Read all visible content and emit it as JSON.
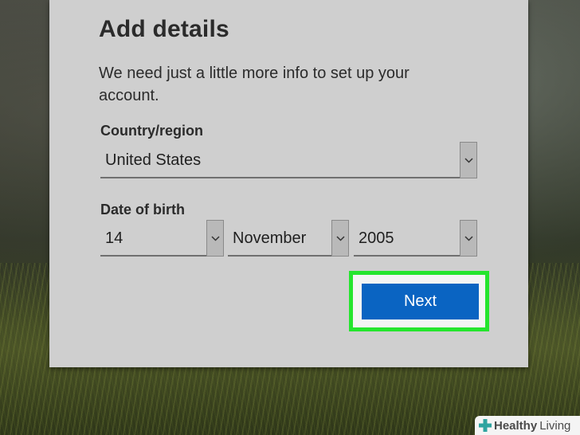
{
  "dialog": {
    "title": "Add details",
    "intro": "We need just a little more info to set up your account.",
    "country": {
      "label": "Country/region",
      "value": "United States"
    },
    "birth": {
      "label": "Date of birth",
      "day": "14",
      "month": "November",
      "year": "2005"
    },
    "next_label": "Next",
    "highlight_color": "#25e52e",
    "button_color": "#0a64c2"
  },
  "watermark": {
    "brand_a": "Healthy",
    "brand_b": "Living",
    "icon": "medical-cross-icon"
  }
}
